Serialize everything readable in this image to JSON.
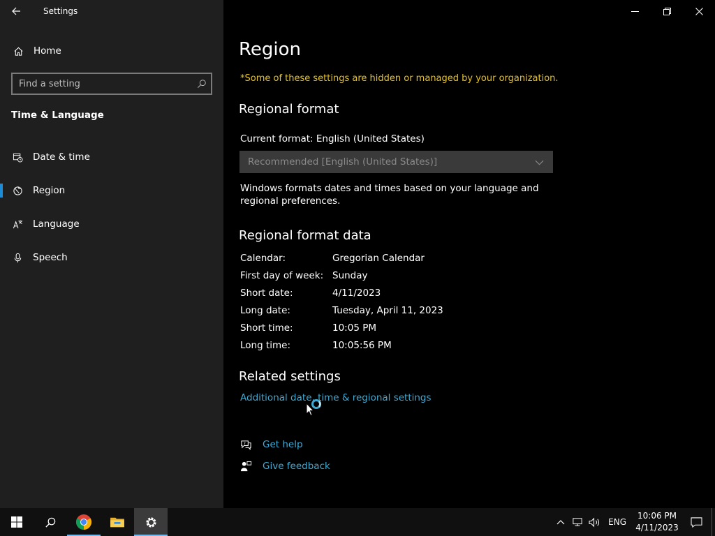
{
  "window": {
    "title": "Settings",
    "minimize_icon": "minimize-icon",
    "restore_icon": "restore-icon",
    "close_icon": "close-icon"
  },
  "sidebar": {
    "home_label": "Home",
    "search_placeholder": "Find a setting",
    "section_title": "Time & Language",
    "items": [
      {
        "label": "Date & time",
        "icon": "calendar-clock-icon",
        "active": false
      },
      {
        "label": "Region",
        "icon": "globe-icon",
        "active": true
      },
      {
        "label": "Language",
        "icon": "language-icon",
        "active": false
      },
      {
        "label": "Speech",
        "icon": "microphone-icon",
        "active": false
      }
    ]
  },
  "main": {
    "title": "Region",
    "managed_note": "*Some of these settings are hidden or managed by your organization.",
    "regional_format": {
      "heading": "Regional format",
      "current": "Current format: English (United States)",
      "dropdown_value": "Recommended [English (United States)]",
      "description": "Windows formats dates and times based on your language and regional preferences."
    },
    "format_data": {
      "heading": "Regional format data",
      "rows": [
        {
          "key": "Calendar:",
          "value": "Gregorian Calendar"
        },
        {
          "key": "First day of week:",
          "value": "Sunday"
        },
        {
          "key": "Short date:",
          "value": "4/11/2023"
        },
        {
          "key": "Long date:",
          "value": "Tuesday, April 11, 2023"
        },
        {
          "key": "Short time:",
          "value": "10:05 PM"
        },
        {
          "key": "Long time:",
          "value": "10:05:56 PM"
        }
      ]
    },
    "related": {
      "heading": "Related settings",
      "link": "Additional date, time & regional settings"
    },
    "help": {
      "get_help": "Get help",
      "give_feedback": "Give feedback"
    }
  },
  "taskbar": {
    "tray_language": "ENG",
    "time": "10:06 PM",
    "date": "4/11/2023"
  },
  "colors": {
    "accent": "#1a8cd8",
    "link": "#3fa9d4",
    "warning": "#e6c229",
    "sidebar_bg": "#1f1f1f"
  }
}
